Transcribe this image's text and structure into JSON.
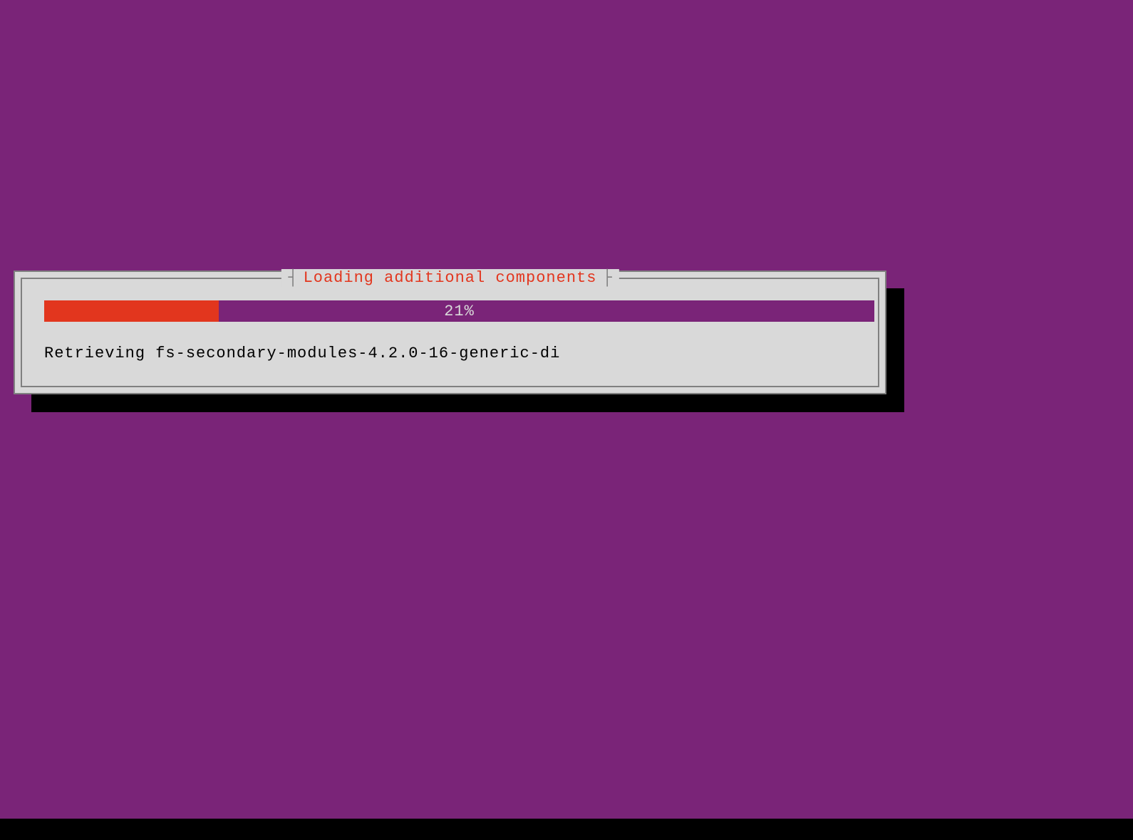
{
  "dialog": {
    "title": "Loading additional components",
    "progress_percent": 21,
    "progress_text": "21%",
    "status_message": "Retrieving fs-secondary-modules-4.2.0-16-generic-di"
  },
  "colors": {
    "background": "#7a2478",
    "dialog_bg": "#d9d9d9",
    "border": "#808080",
    "progress_fill": "#e2361e",
    "title_color": "#e2361e",
    "shadow": "#000000"
  }
}
